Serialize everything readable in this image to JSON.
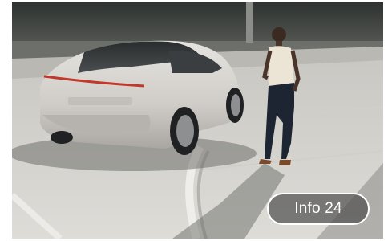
{
  "badge": {
    "label": "Info 24"
  },
  "colors": {
    "badge_background": "#505050",
    "badge_border": "#ffffff",
    "badge_text": "#ffffff",
    "car_body": "#d9d7d3",
    "pavement": "#d6d5d1"
  },
  "scene": {
    "subjects": [
      "car",
      "person"
    ]
  }
}
